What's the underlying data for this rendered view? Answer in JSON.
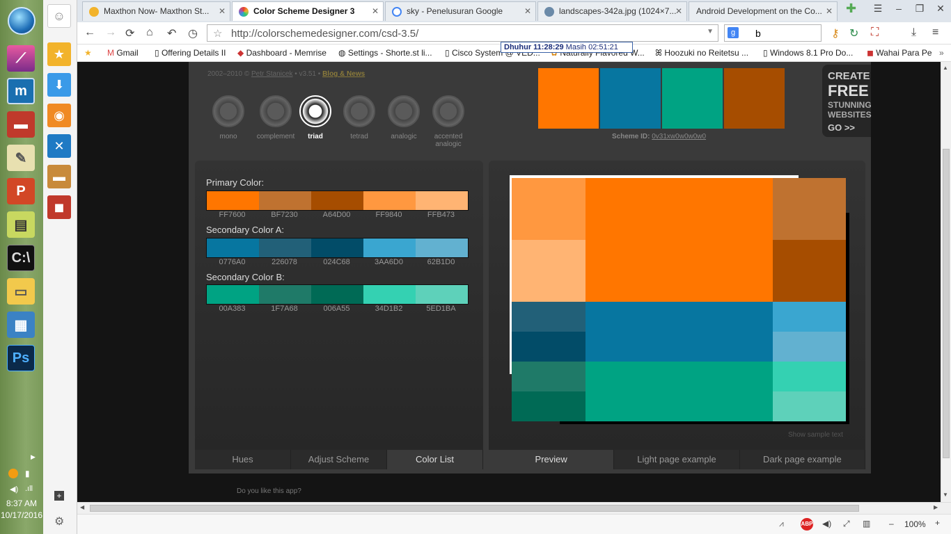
{
  "taskbar": {
    "time": "8:37 AM",
    "date": "10/17/2016"
  },
  "tabs": [
    {
      "label": "Maxthon Now- Maxthon St...",
      "color": "#f2b32b"
    },
    {
      "label": "Color Scheme Designer 3",
      "color": "#e8402f"
    },
    {
      "label": "sky - Penelusuran Google",
      "color": "#4285f4"
    },
    {
      "label": "landscapes-342a.jpg (1024×7...",
      "color": "#6b8aa8"
    },
    {
      "label": "Android Development on the Co...",
      "color": "#cccccc"
    }
  ],
  "toolbar": {
    "url": "http://colorschemedesigner.com/csd-3.5/",
    "search_value": "b"
  },
  "tooltip": {
    "label": "Dhuhur",
    "time": "11:28:29",
    "remaining": "Masih 02:51:21"
  },
  "bookmarks": [
    "Gmail",
    "Offering Details II",
    "Dashboard - Memrise",
    "Settings - Shorte.st li...",
    "Cisco System @ VED...",
    "Naturally Flavored W...",
    "Hoozuki no Reitetsu ...",
    "Windows 8.1 Pro Do...",
    "Wahai Para Pe"
  ],
  "app": {
    "credit_years": "2002–2010 ©",
    "credit_author": "Petr Stanicek",
    "credit_version": "• v3.51 •",
    "credit_blog": "Blog & News",
    "modes": [
      "mono",
      "complement",
      "triad",
      "tetrad",
      "analogic",
      "accented analogic"
    ],
    "selected_mode": "triad",
    "scheme_colors": [
      "#FF7600",
      "#0776A0",
      "#00A383",
      "#A64D00"
    ],
    "scheme_id_label": "Scheme ID:",
    "scheme_id": "0v31xw0w0w0w0",
    "ad": {
      "line1": "CREATE",
      "line2": "FREE",
      "line3": "STUNNING",
      "line4": "WEBSITES",
      "go": "GO >>"
    },
    "groups": [
      {
        "title": "Primary Color:",
        "colors": [
          "FF7600",
          "BF7230",
          "A64D00",
          "FF9840",
          "FFB473"
        ]
      },
      {
        "title": "Secondary Color A:",
        "colors": [
          "0776A0",
          "226078",
          "024C68",
          "3AA6D0",
          "62B1D0"
        ]
      },
      {
        "title": "Secondary Color B:",
        "colors": [
          "00A383",
          "1F7A68",
          "006A55",
          "34D1B2",
          "5ED1BA"
        ]
      }
    ],
    "left_tabs": [
      "Hues",
      "Adjust Scheme",
      "Color List"
    ],
    "left_tab_selected": 2,
    "right_tabs": [
      "Preview",
      "Light page example",
      "Dark page example"
    ],
    "right_tab_selected": 0,
    "sample_text": "Show sample text",
    "like_app": "Do you like this app?"
  },
  "status": {
    "zoom": "100%"
  }
}
